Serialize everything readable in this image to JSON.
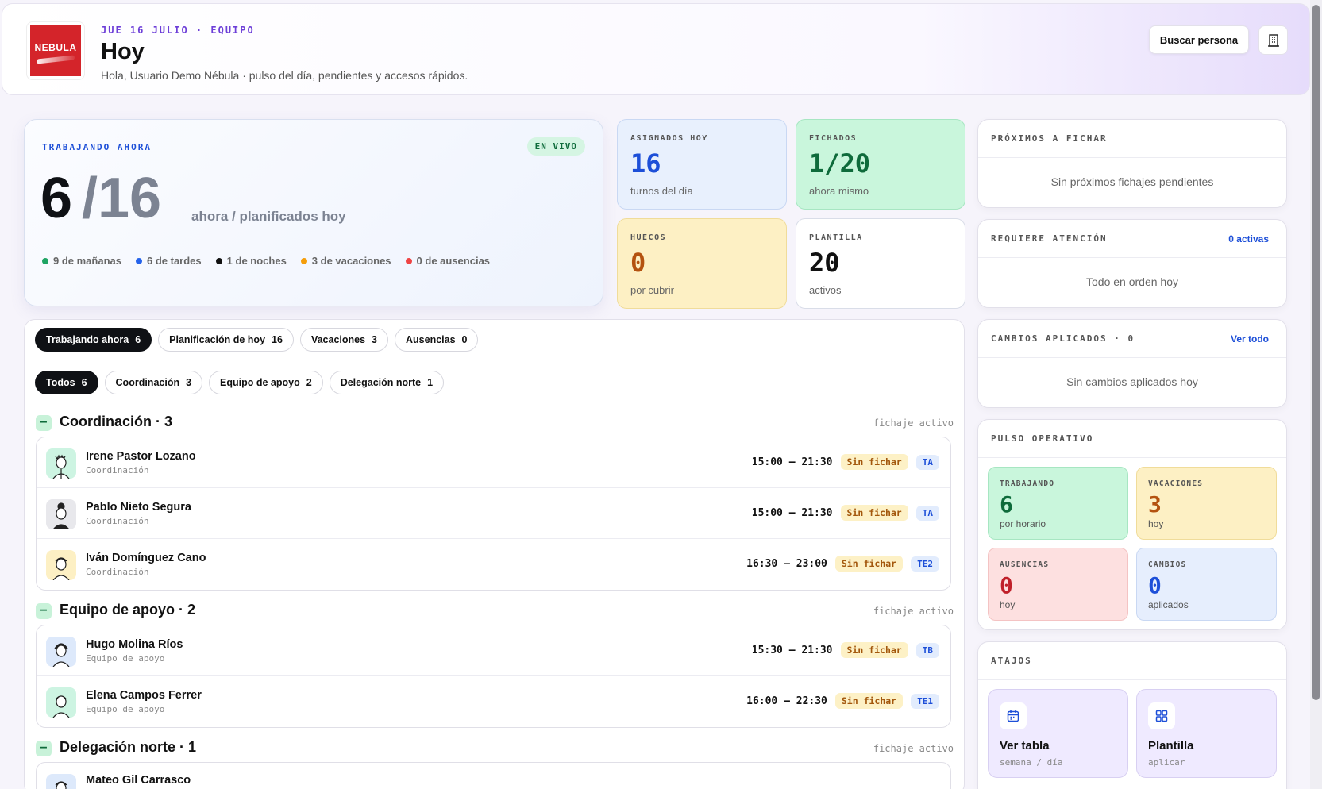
{
  "header": {
    "logo_text": "NEBULA",
    "eyebrow": "JUE 16 JULIO · EQUIPO",
    "title": "Hoy",
    "subtitle": "Hola, Usuario Demo Nébula · pulso del día, pendientes y accesos rápidos.",
    "search_label": "Buscar persona",
    "building_icon": "building-icon"
  },
  "live": {
    "label": "TRABAJANDO AHORA",
    "badge": "EN VIVO",
    "now": "6",
    "planned": "/16",
    "caption": "ahora / planificados hoy",
    "breakdown": [
      {
        "text": "9 de mañanas",
        "color": "#1fa463"
      },
      {
        "text": "6 de tardes",
        "color": "#2563eb"
      },
      {
        "text": "1 de noches",
        "color": "#111111"
      },
      {
        "text": "3 de vacaciones",
        "color": "#f59e0b"
      },
      {
        "text": "0 de ausencias",
        "color": "#ef4444"
      }
    ]
  },
  "kpis": {
    "assigned": {
      "label": "ASIGNADOS HOY",
      "value": "16",
      "sub": "turnos del día"
    },
    "checked": {
      "label": "FICHADOS",
      "value": "1/20",
      "sub": "ahora mismo"
    },
    "gaps": {
      "label": "HUECOS",
      "value": "0",
      "sub": "por cubrir"
    },
    "staff": {
      "label": "PLANTILLA",
      "value": "20",
      "sub": "activos"
    }
  },
  "right": {
    "next": {
      "title": "PRÓXIMOS A FICHAR",
      "empty": "Sin próximos fichajes pendientes"
    },
    "attention": {
      "title": "REQUIERE ATENCIÓN",
      "link": "0 activas",
      "empty": "Todo en orden hoy"
    },
    "changes": {
      "title": "CAMBIOS APLICADOS · 0",
      "link": "Ver todo",
      "empty": "Sin cambios aplicados hoy"
    },
    "pulse": {
      "title": "PULSO OPERATIVO",
      "working": {
        "label": "TRABAJANDO",
        "value": "6",
        "sub": "por horario"
      },
      "vacations": {
        "label": "VACACIONES",
        "value": "3",
        "sub": "hoy"
      },
      "absences": {
        "label": "AUSENCIAS",
        "value": "0",
        "sub": "hoy"
      },
      "changes": {
        "label": "CAMBIOS",
        "value": "0",
        "sub": "aplicados"
      }
    },
    "shortcuts": {
      "title": "ATAJOS",
      "table": {
        "title": "Ver tabla",
        "sub": "semana / día"
      },
      "staff": {
        "title": "Plantilla",
        "sub": "aplicar"
      }
    }
  },
  "tabs": [
    {
      "label": "Trabajando ahora",
      "count": "6"
    },
    {
      "label": "Planificación de hoy",
      "count": "16"
    },
    {
      "label": "Vacaciones",
      "count": "3"
    },
    {
      "label": "Ausencias",
      "count": "0"
    }
  ],
  "filters": [
    {
      "label": "Todos",
      "count": "6"
    },
    {
      "label": "Coordinación",
      "count": "3"
    },
    {
      "label": "Equipo de apoyo",
      "count": "2"
    },
    {
      "label": "Delegación norte",
      "count": "1"
    }
  ],
  "groups": {
    "coord": {
      "title": "Coordinación · 3",
      "meta": "fichaje activo",
      "rows": [
        {
          "name": "Irene Pastor Lozano",
          "dept": "Coordinación",
          "time": "15:00 – 21:30",
          "status": "Sin fichar",
          "code": "TA"
        },
        {
          "name": "Pablo Nieto Segura",
          "dept": "Coordinación",
          "time": "15:00 – 21:30",
          "status": "Sin fichar",
          "code": "TA"
        },
        {
          "name": "Iván Domínguez Cano",
          "dept": "Coordinación",
          "time": "16:30 – 23:00",
          "status": "Sin fichar",
          "code": "TE2"
        }
      ]
    },
    "support": {
      "title": "Equipo de apoyo · 2",
      "meta": "fichaje activo",
      "rows": [
        {
          "name": "Hugo Molina Ríos",
          "dept": "Equipo de apoyo",
          "time": "15:30 – 21:30",
          "status": "Sin fichar",
          "code": "TB"
        },
        {
          "name": "Elena Campos Ferrer",
          "dept": "Equipo de apoyo",
          "time": "16:00 – 22:30",
          "status": "Sin fichar",
          "code": "TE1"
        }
      ]
    },
    "north": {
      "title": "Delegación norte · 1",
      "meta": "fichaje activo",
      "rows": [
        {
          "name": "Mateo Gil Carrasco"
        }
      ]
    }
  }
}
